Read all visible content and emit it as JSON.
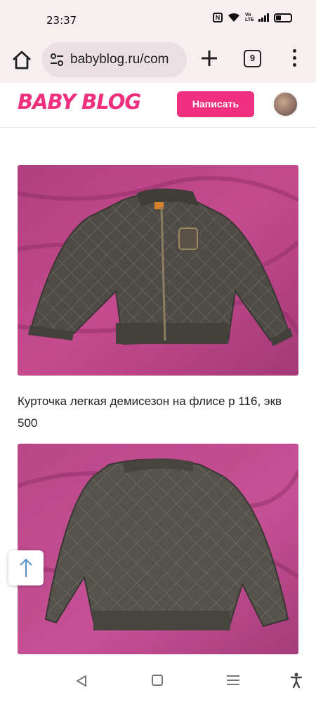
{
  "status_bar": {
    "time": "23:37",
    "icons": [
      "nfc-icon",
      "wifi-icon",
      "volte-icon",
      "signal-icon",
      "battery-icon"
    ],
    "volte_label": "Vo LTE",
    "nfc_label": "N"
  },
  "browser": {
    "url": "babyblog.ru/com",
    "tab_count": "9"
  },
  "site": {
    "logo": "BABY BLOG",
    "write_button": "Написать",
    "brand_color": "#f0307e"
  },
  "post": {
    "text": "Курточка легкая демисезон на флисе р 116, экв 500"
  }
}
